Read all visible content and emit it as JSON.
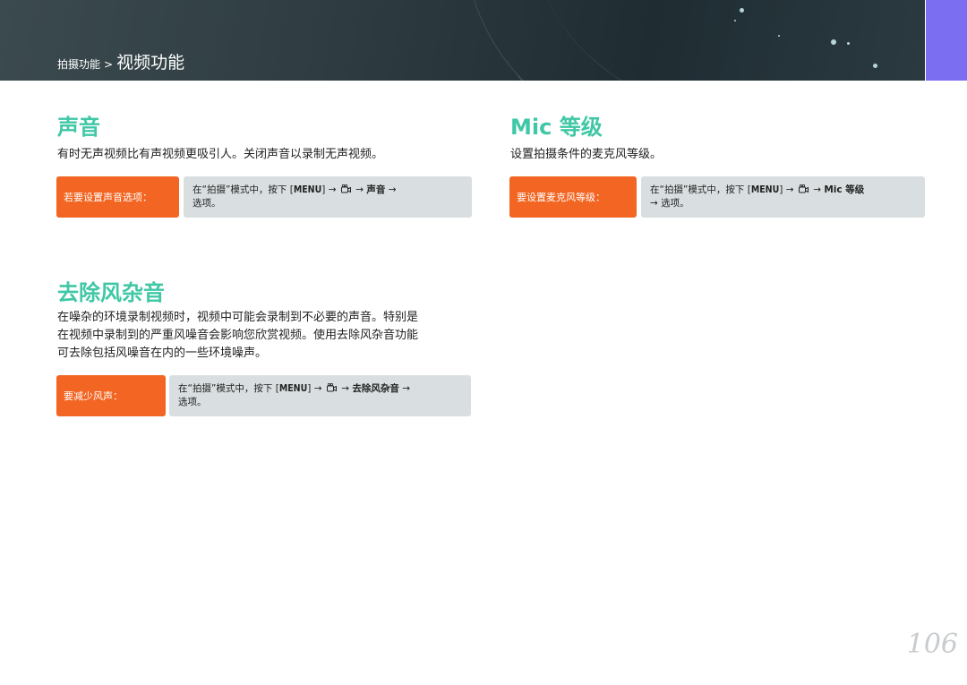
{
  "breadcrumb": {
    "parent": "拍摄功能",
    "separator": ">",
    "current": "视频功能"
  },
  "sections": {
    "sound": {
      "title": "声音",
      "description": "有时无声视频比有声视频更吸引人。关闭声音以录制无声视频。",
      "tip_label": "若要设置声音选项：",
      "tip": {
        "prefix": "在“拍摄”模式中，按下 [",
        "menu": "MENU",
        "after_menu": "] →",
        "arrow": "→",
        "target": "声音",
        "arrow2": "→",
        "suffix": "选项。"
      }
    },
    "mic": {
      "title": "Mic 等级",
      "description": "设置拍摄条件的麦克风等级。",
      "tip_label": "要设置麦克风等级：",
      "tip": {
        "prefix": "在“拍摄”模式中，按下 [",
        "menu": "MENU",
        "after_menu": "] →",
        "arrow": "→",
        "target": "Mic 等级",
        "suffix": "→ 选项。"
      }
    },
    "wind": {
      "title": "去除风杂音",
      "description_lines": [
        "在噪杂的环境录制视频时，视频中可能会录制到不必要的声音。特别是",
        "在视频中录制到的严重风噪音会影响您欣赏视频。使用去除风杂音功能",
        "可去除包括风噪音在内的一些环境噪声。"
      ],
      "tip_label": "要减少风声：",
      "tip": {
        "prefix": "在“拍摄”模式中，按下 [",
        "menu": "MENU",
        "after_menu": "] →",
        "arrow": "→",
        "target": "去除风杂音",
        "arrow2": "→",
        "suffix": "选项。"
      }
    }
  },
  "icons": {
    "video_mode": "video-camera-icon"
  },
  "colors": {
    "accent_green": "#3fc7a6",
    "tip_orange": "#f26522",
    "tip_gray": "#d9dfe1",
    "header_dark": "#2f3d42",
    "accent_purple": "#7b6ef0"
  },
  "page_number": "106"
}
